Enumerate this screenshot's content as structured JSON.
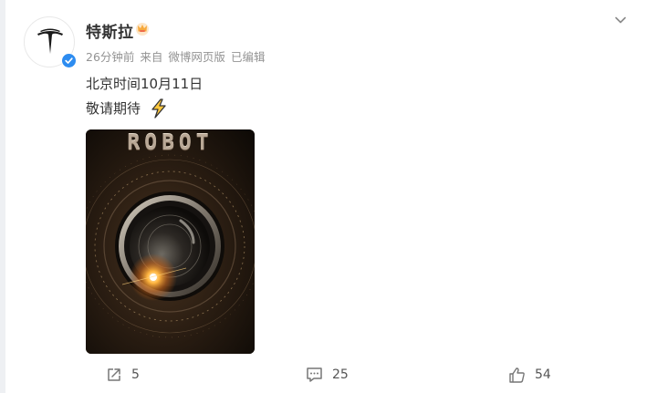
{
  "author": {
    "name": "特斯拉"
  },
  "meta": {
    "time": "26分钟前",
    "source_prefix": "来自",
    "source": "微博网页版",
    "edited": "已编辑"
  },
  "post": {
    "lines": [
      "北京时间10月11日",
      "敬请期待"
    ],
    "image": {
      "title": "ROBOT"
    }
  },
  "actions": {
    "share_count": "5",
    "comment_count": "25",
    "like_count": "54"
  },
  "icons": {
    "avatar": "tesla-logo",
    "verified": "verified-badge-icon",
    "crown": "crown-icon",
    "menu": "chevron-down-icon",
    "bolt": "lightning-emoji",
    "share": "share-icon",
    "comment": "comment-icon",
    "like": "thumbs-up-icon"
  },
  "colors": {
    "verified": "#2d8cf0",
    "text": "#333333",
    "meta": "#939393",
    "crown": "#f7a93b"
  }
}
